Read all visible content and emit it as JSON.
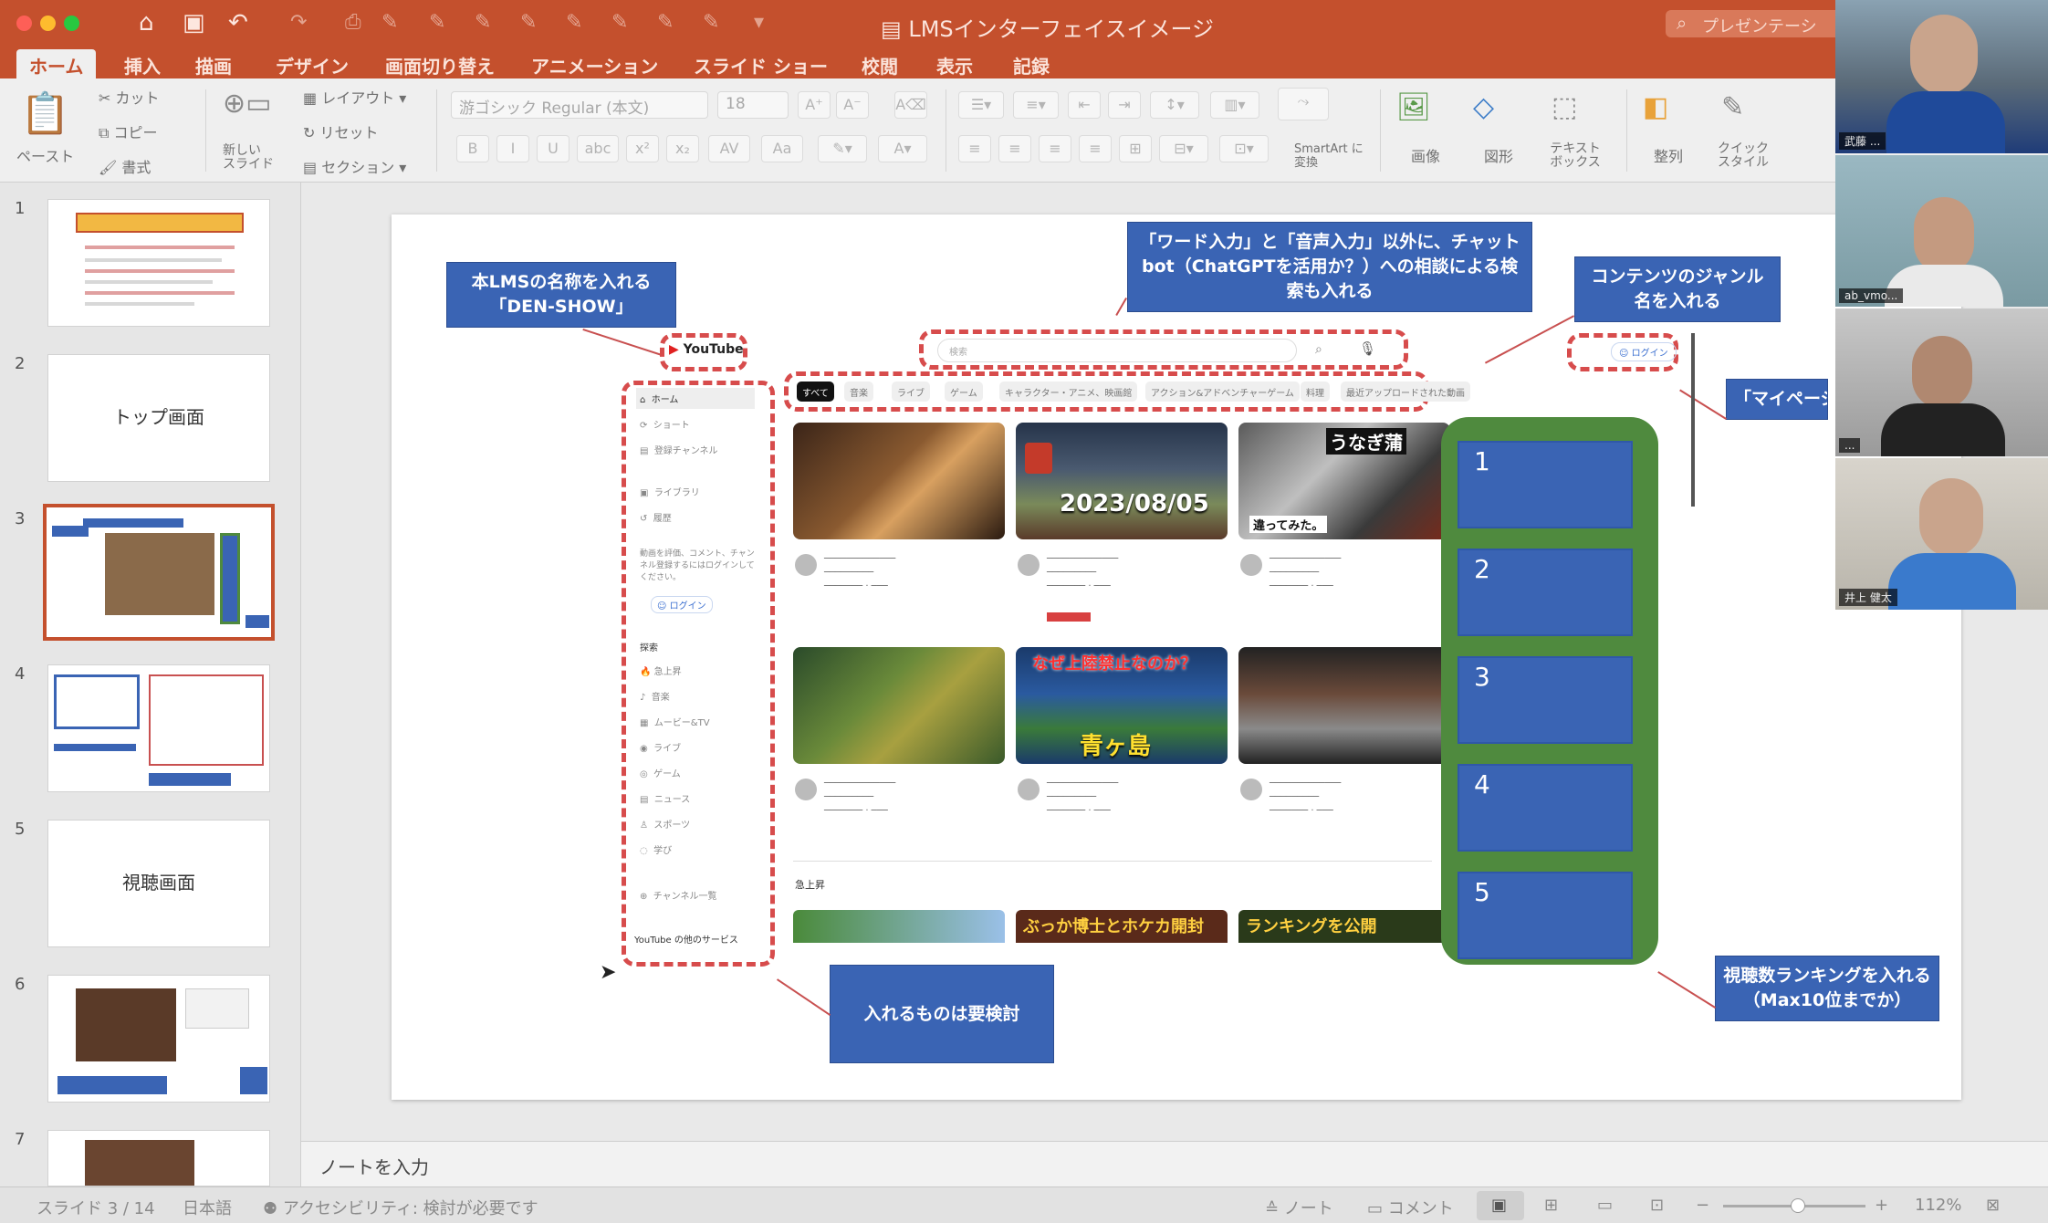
{
  "window": {
    "title": "LMSインターフェイスイメージ",
    "search_placeholder": "プレゼンテーシ"
  },
  "tabs": [
    "ホーム",
    "挿入",
    "描画",
    "デザイン",
    "画面切り替え",
    "アニメーション",
    "スライド ショー",
    "校閲",
    "表示",
    "記録"
  ],
  "ribbon": {
    "paste": "ペースト",
    "cut": "カット",
    "copy": "コピー",
    "format": "書式",
    "new_slide": "新しい スライド",
    "layout": "レイアウト",
    "reset": "リセット",
    "section": "セクション",
    "font_name": "游ゴシック Regular (本文)",
    "font_size": "18",
    "smartart": "SmartArt に変換",
    "picture": "画像",
    "shapes": "図形",
    "textbox": "テキスト ボックス",
    "arrange": "整列",
    "quick_styles": "クイック スタイル"
  },
  "thumbnails": [
    {
      "num": "1",
      "title": ""
    },
    {
      "num": "2",
      "title": "トップ画面"
    },
    {
      "num": "3",
      "title": ""
    },
    {
      "num": "4",
      "title": ""
    },
    {
      "num": "5",
      "title": "視聴画面"
    },
    {
      "num": "6",
      "title": ""
    },
    {
      "num": "7",
      "title": ""
    }
  ],
  "slide": {
    "callout_name": "本LMSの名称を入れる「DEN-SHOW」",
    "callout_search": "「ワード入力」と「音声入力」以外に、チャットbot（ChatGPTを活用か？）への相談による検索も入れる",
    "callout_genre": "コンテンツのジャンル名を入れる",
    "callout_mypage": "「マイページ」のログイン",
    "callout_sidebar": "入れるものは要検討",
    "callout_ranking": "視聴数ランキングを入れる（Max10位までか）",
    "ranking": [
      "1",
      "2",
      "3",
      "4",
      "5"
    ],
    "yt": {
      "logo": "YouTube",
      "search_placeholder": "検索",
      "login": "ログイン",
      "sidebar": [
        "ホーム",
        "ショート",
        "登録チャンネル",
        "ライブラリ",
        "履歴",
        "動画を評価、コメント、チャンネル登録するにはログインしてください。",
        "ログイン",
        "探索",
        "急上昇",
        "音楽",
        "ムービー&TV",
        "ライブ",
        "ゲーム",
        "ニュース",
        "スポーツ",
        "学び",
        "チャンネル一覧",
        "YouTube の他のサービス"
      ],
      "chips": [
        "すべて",
        "音楽",
        "ライブ",
        "ゲーム",
        "キャラクター・アニメ、映画館",
        "アクション&アドベンチャーゲーム",
        "料理",
        "最近アップロードされた動画"
      ],
      "overlay_date": "2023/08/05",
      "overlay_unagi": "うなぎ蒲",
      "overlay_unagi2": "違ってみた。",
      "overlay_naze": "なぜ上陸禁止なのか？",
      "overlay_aogashima": "青ヶ島",
      "section_trending": "急上昇",
      "overlay_hakase": "ぶっか博士とホケカ開封",
      "overlay_rank": "ランキングを公開"
    }
  },
  "notes": "ノートを入力",
  "status": {
    "slide": "スライド 3 / 14",
    "lang": "日本語",
    "accessibility": "アクセシビリティ: 検討が必要です",
    "notes": "ノート",
    "comments": "コメント",
    "zoom": "112%"
  },
  "participants": [
    "武藤 ...",
    "ab_vmo...",
    "...",
    "井上 健太"
  ]
}
